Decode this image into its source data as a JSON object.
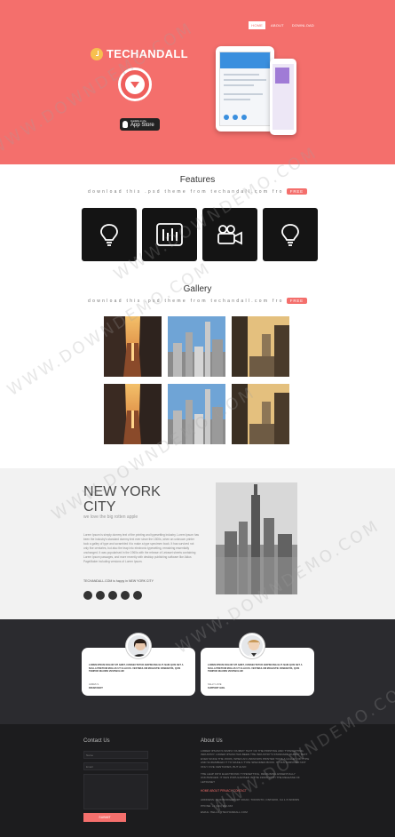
{
  "nav": {
    "items": [
      "HOME",
      "ABOUT",
      "DOWNLOAD"
    ]
  },
  "hero": {
    "logo": "TECHANDALL",
    "appstore_small": "Available on the",
    "appstore_big": "App Store"
  },
  "features": {
    "title": "Features",
    "subtitle": "download this .psd theme from techandall.com fro",
    "badge": "FREE",
    "icons": [
      "lightbulb-icon",
      "equalizer-icon",
      "video-camera-icon",
      "lightbulb-icon"
    ]
  },
  "gallery": {
    "title": "Gallery",
    "subtitle": "download this .psd theme from techandall.com fro",
    "badge": "FREE"
  },
  "newyork": {
    "title": "NEW YORK CITY",
    "subtitle": "we love the big rotten apple",
    "body": "Lorem Ipsum is simply dummy text of the printing and typesetting industry. Lorem Ipsum has been the industry's standard dummy text ever since the 1500s, when an unknown printer took a galley of type and scrambled it to make a type specimen book. It has survived not only five centuries, but also the leap into electronic typesetting, remaining essentially unchanged. It was popularised in the 1960s with the release of Letraset sheets containing Lorem Ipsum passages, and more recently with desktop publishing software like Aldus PageMaker including versions of Lorem Ipsum.",
    "link": "TECHANDALL.COM is happy in NEW YORK CITY"
  },
  "testimonials": [
    {
      "text": "LOREM IPSUM DOLOR SIT AMET, CONSECTETUR ADIPISCING ELIT. NAM QUIS SET A NULLA PRETIUM MOLLIS UT ULLICUS. VESTIBULUM MOLESTIE VENENATIS, QUIS TEMPOR MAURIS VESTIBULUM",
      "name": "JAMES S.",
      "role": "DRUM KNOT"
    },
    {
      "text": "LOREM IPSUM DOLOR SIT AMET, CONSECTETUR ADIPISCING ELIT. NAM QUIS SET A NULLA PRETIUM MOLLIS UT ULLICUS. VESTIBULUM MOLESTIE VENENATIS, QUIS TEMPOR MAURIS VESTIBULUM",
      "name": "SALLY LOVE",
      "role": "SUPPORT GIRL"
    }
  ],
  "footer": {
    "contact_title": "Contact Us",
    "name_placeholder": "Name",
    "email_placeholder": "Email",
    "submit": "SUBMIT",
    "about_title": "About Us",
    "about_p1": "LOREM IPSUM IS SIMPLY DUMMY TEXT OF THE PRINTING AND TYPESETTING INDUSTRY. LOREM IPSUM HAS BEEN THE INDUSTRY'S STANDARD DUMMY TEXT EVER SINCE THE 1500S, WHEN AN UNKNOWN PRINTER TOOK A GALLEY OF TYPE AND SCRAMBLED IT TO MAKE A TYPE SPECIMEN BOOK. IT HAS SURVIVED NOT ONLY FIVE CENTURIES, BUT ALSO",
    "about_p2": "THE LEAP INTO ELECTRONIC TYPESETTING, REMAINING ESSENTIALLY UNCHANGED. IT WAS POPULARISED IN THE 1960S WITH THE RELEASE OF LETRASET",
    "links": "HOME   ABOUT   PRIVACY   CONTACT",
    "address": "ADDRESS: 3949 BRIDGEPORT ROAD, TORONTO, ONTARIO, CA 1-5 WORDS",
    "phone": "PHONE: +1 (111) 222-333",
    "email": "EMAIL: HELLO@TECHANDALL.COM"
  },
  "watermark": "WWW.DOWNDEMO.COM",
  "colors": {
    "accent": "#f46f6c",
    "dark": "#2b2b2f",
    "footer": "#1c1c1e"
  }
}
